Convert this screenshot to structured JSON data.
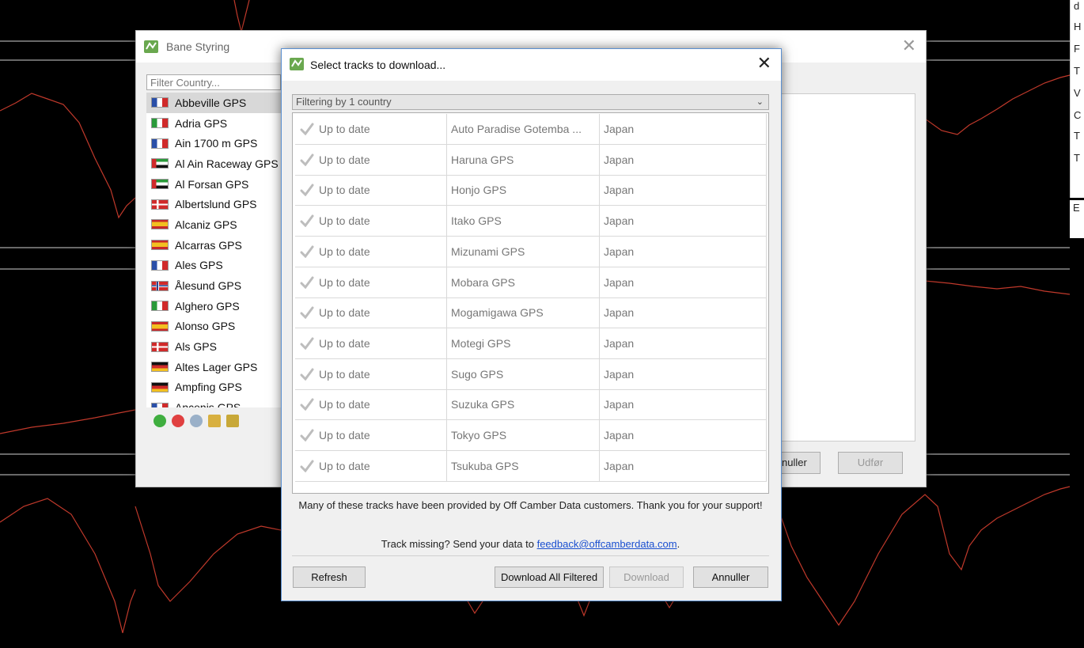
{
  "background": {
    "right_panel_letters": [
      "d",
      "H",
      "F",
      "T",
      "V",
      "C",
      "T",
      "T"
    ],
    "right_panel_bottom_letter": "E"
  },
  "track_manager": {
    "title": "Bane Styring",
    "filter_placeholder": "Filter Country...",
    "tracks": [
      {
        "name": "Abbeville GPS",
        "flag": "france"
      },
      {
        "name": "Adria GPS",
        "flag": "italy"
      },
      {
        "name": "Ain 1700 m GPS",
        "flag": "france"
      },
      {
        "name": "Al Ain Raceway GPS",
        "flag": "uae"
      },
      {
        "name": "Al Forsan GPS",
        "flag": "uae"
      },
      {
        "name": "Albertslund GPS",
        "flag": "denmark"
      },
      {
        "name": "Alcaniz GPS",
        "flag": "spain"
      },
      {
        "name": "Alcarras GPS",
        "flag": "spain"
      },
      {
        "name": "Ales GPS",
        "flag": "france"
      },
      {
        "name": "Ålesund GPS",
        "flag": "norway"
      },
      {
        "name": "Alghero GPS",
        "flag": "italy"
      },
      {
        "name": "Alonso GPS",
        "flag": "spain"
      },
      {
        "name": "Als GPS",
        "flag": "denmark"
      },
      {
        "name": "Altes Lager GPS",
        "flag": "germany"
      },
      {
        "name": "Ampfing GPS",
        "flag": "germany"
      },
      {
        "name": "Ancenis GPS",
        "flag": "france"
      }
    ],
    "cancel_label": "Annuller",
    "apply_label": "Udfør"
  },
  "download_dialog": {
    "title": "Select tracks to download...",
    "filter_text": "Filtering by 1 country",
    "rows": [
      {
        "status": "Up to date",
        "track": "Auto Paradise Gotemba ...",
        "country": "Japan"
      },
      {
        "status": "Up to date",
        "track": "Haruna GPS",
        "country": "Japan"
      },
      {
        "status": "Up to date",
        "track": "Honjo GPS",
        "country": "Japan"
      },
      {
        "status": "Up to date",
        "track": "Itako GPS",
        "country": "Japan"
      },
      {
        "status": "Up to date",
        "track": "Mizunami GPS",
        "country": "Japan"
      },
      {
        "status": "Up to date",
        "track": "Mobara GPS",
        "country": "Japan"
      },
      {
        "status": "Up to date",
        "track": "Mogamigawa GPS",
        "country": "Japan"
      },
      {
        "status": "Up to date",
        "track": "Motegi GPS",
        "country": "Japan"
      },
      {
        "status": "Up to date",
        "track": "Sugo GPS",
        "country": "Japan"
      },
      {
        "status": "Up to date",
        "track": "Suzuka GPS",
        "country": "Japan"
      },
      {
        "status": "Up to date",
        "track": "Tokyo GPS",
        "country": "Japan"
      },
      {
        "status": "Up to date",
        "track": "Tsukuba GPS",
        "country": "Japan"
      }
    ],
    "info_text": "Many of these tracks have been provided by Off Camber Data customers. Thank you for your support!",
    "missing_prefix": "Track missing? Send your data to ",
    "missing_email": "feedback@offcamberdata.com",
    "missing_suffix": ".",
    "buttons": {
      "refresh": "Refresh",
      "download_all": "Download All Filtered",
      "download": "Download",
      "cancel": "Annuller"
    }
  },
  "colors": {
    "graph_line": "#c0392b",
    "link": "#1a4fd0",
    "accent_border": "#5a8fd0"
  }
}
